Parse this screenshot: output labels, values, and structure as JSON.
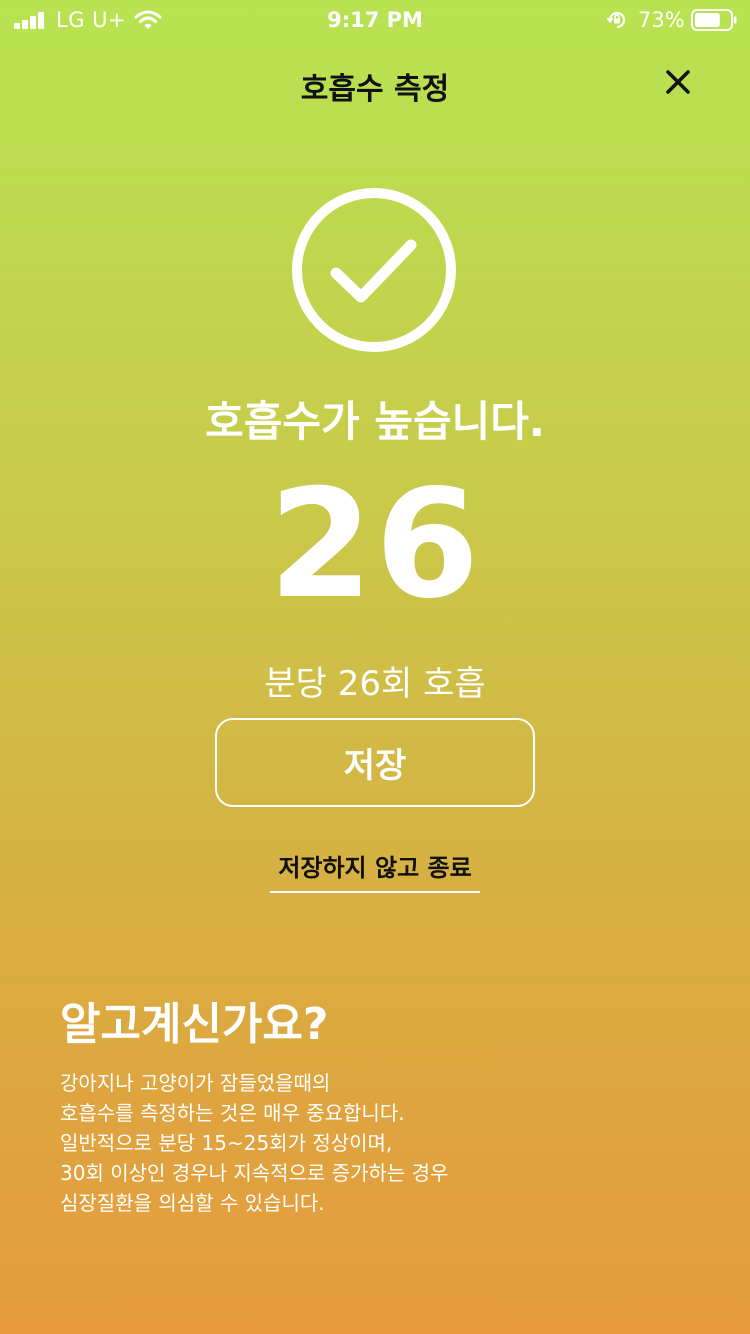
{
  "status_bar": {
    "carrier": "LG U+",
    "time": "9:17 PM",
    "battery_percent": "73%",
    "battery_level": 0.73,
    "signal_bars": 4
  },
  "header": {
    "title": "호흡수 측정",
    "close_icon": "close-icon"
  },
  "result": {
    "icon": "check-circle-icon",
    "message": "호흡수가 높습니다.",
    "value": "26",
    "per_minute_text": "분당 26회 호흡"
  },
  "actions": {
    "save_label": "저장",
    "exit_label": "저장하지 않고 종료"
  },
  "info": {
    "heading": "알고계신가요?",
    "lines": [
      "강아지나 고양이가 잠들었을때의",
      "호흡수를 측정하는 것은 매우 중요합니다.",
      "일반적으로 분당 15~25회가 정상이며,",
      "30회 이상인 경우나 지속적으로 증가하는 경우",
      "심장질환을 의심할 수 있습니다."
    ]
  },
  "colors": {
    "gradient_top": "#b7e352",
    "gradient_mid": "#c9c94a",
    "gradient_bottom": "#e69a3c",
    "text_light": "#ffffff",
    "text_dark": "#111111"
  }
}
